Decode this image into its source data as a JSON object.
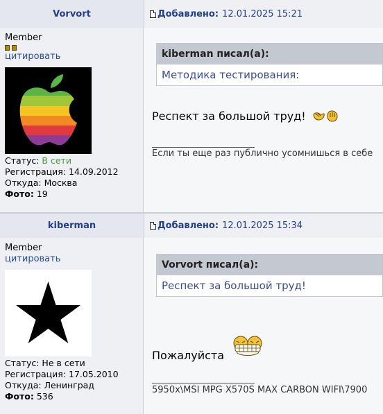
{
  "posts": [
    {
      "username": "Vorvort",
      "posted_label": "Добавлено:",
      "posted_date": "12.01.2025 15:21",
      "rank": "Member",
      "cite_label": "цитировать",
      "avatar": "apple-logo-rainbow",
      "status_label": "Статус:",
      "status_value": "В сети",
      "reg_label": "Регистрация:",
      "reg_value": "14.09.2012",
      "from_label": "Откуда:",
      "from_value": "Москва",
      "photo_label": "Фото:",
      "photo_value": "19",
      "quote_author": "kiberman писал(а):",
      "quote_text": "Методика тестирования:",
      "message": "Респект за большой труд!",
      "signature_separator": "_________________",
      "signature": "Если ты еще раз публично усомнишься в себе"
    },
    {
      "username": "kiberman",
      "posted_label": "Добавлено:",
      "posted_date": "12.01.2025 15:34",
      "rank": "Member",
      "cite_label": "цитировать",
      "avatar": "black-star",
      "status_label": "Статус:",
      "status_value": "Не в сети",
      "reg_label": "Регистрация:",
      "reg_value": "17.05.2010",
      "from_label": "Откуда:",
      "from_value": "Ленинград",
      "photo_label": "Фото:",
      "photo_value": "536",
      "quote_author": "Vorvort писал(а):",
      "quote_text": "Респект за большой труд!",
      "message": "Пожалуйста",
      "signature_separator": "_________________",
      "signature": "5950x\\MSI MPG X570S MAX CARBON WIFI\\7900"
    }
  ],
  "colors": {
    "link": "#243f86",
    "online": "#4a9a3a"
  }
}
